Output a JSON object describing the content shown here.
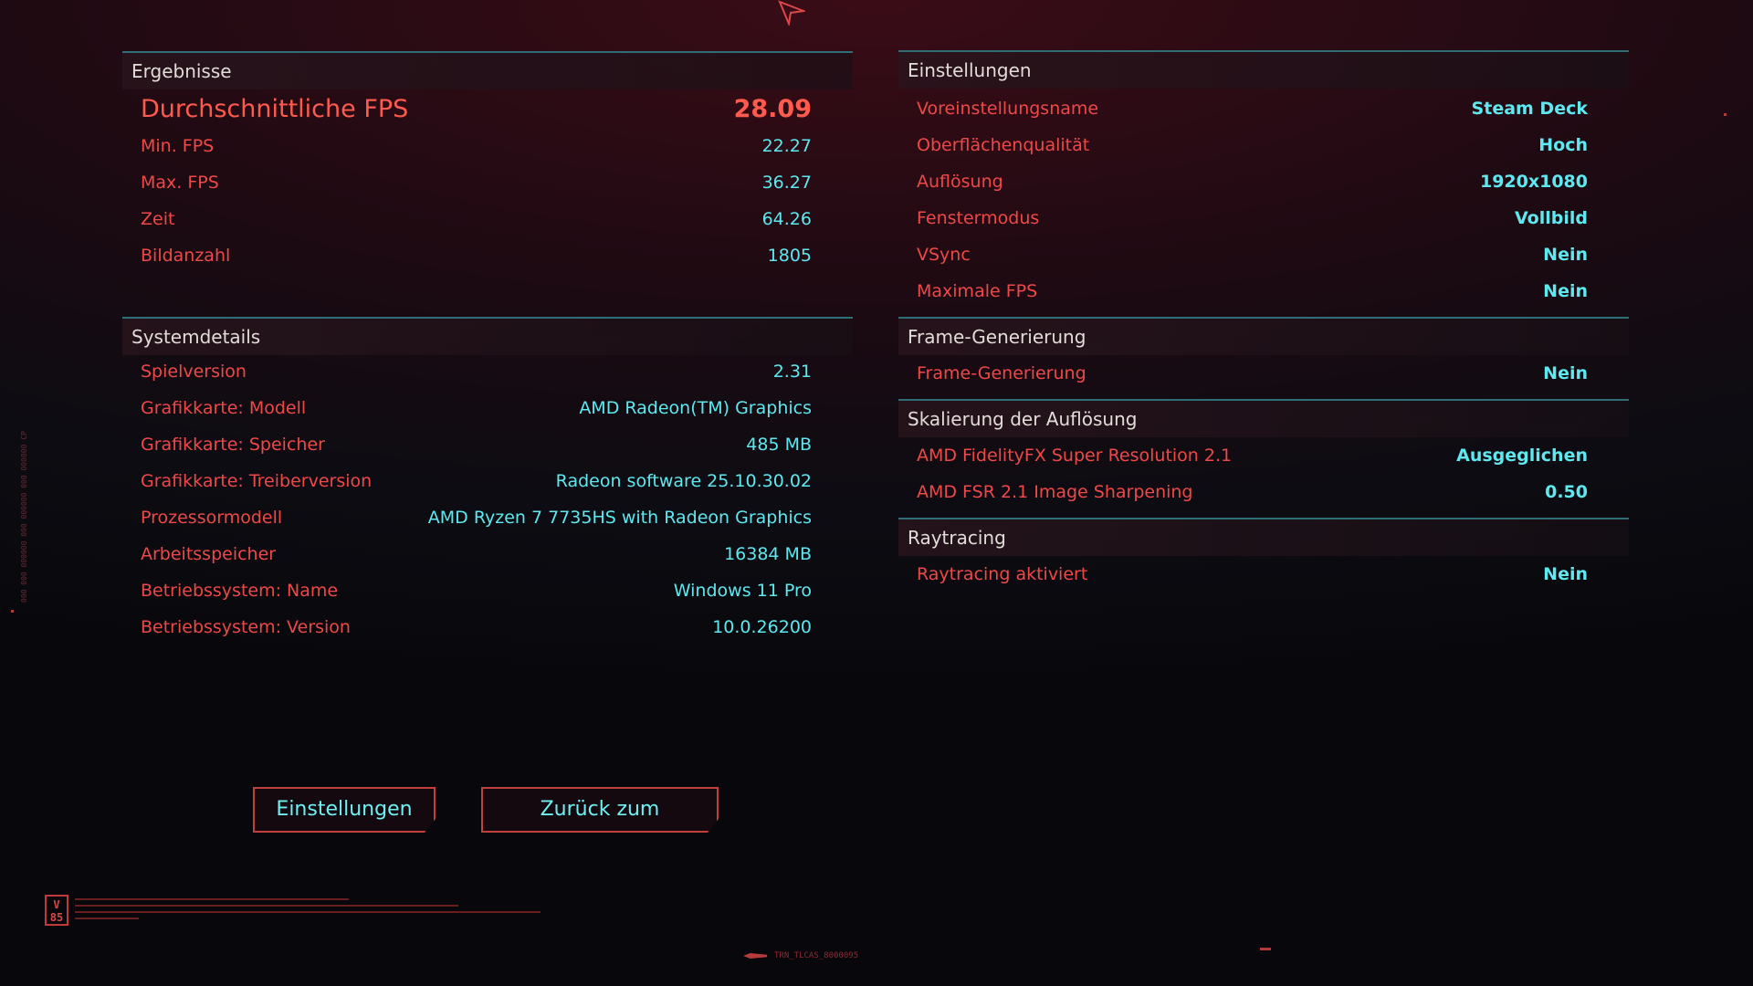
{
  "results": {
    "header": "Ergebnisse",
    "rows": [
      {
        "label": "Durchschnittliche FPS",
        "value": "28.09"
      },
      {
        "label": "Min. FPS",
        "value": "22.27"
      },
      {
        "label": "Max. FPS",
        "value": "36.27"
      },
      {
        "label": "Zeit",
        "value": "64.26"
      },
      {
        "label": "Bildanzahl",
        "value": "1805"
      }
    ]
  },
  "system": {
    "header": "Systemdetails",
    "rows": [
      {
        "label": "Spielversion",
        "value": "2.31"
      },
      {
        "label": "Grafikkarte: Modell",
        "value": "AMD Radeon(TM) Graphics"
      },
      {
        "label": "Grafikkarte: Speicher",
        "value": "485 MB"
      },
      {
        "label": "Grafikkarte: Treiberversion",
        "value": "Radeon software 25.10.30.02"
      },
      {
        "label": "Prozessormodell",
        "value": "AMD Ryzen 7 7735HS with Radeon Graphics"
      },
      {
        "label": "Arbeitsspeicher",
        "value": "16384 MB"
      },
      {
        "label": "Betriebssystem: Name",
        "value": "Windows 11 Pro"
      },
      {
        "label": "Betriebssystem: Version",
        "value": "10.0.26200"
      }
    ]
  },
  "settings": {
    "header": "Einstellungen",
    "rows": [
      {
        "label": "Voreinstellungsname",
        "value": "Steam Deck"
      },
      {
        "label": "Oberflächenqualität",
        "value": "Hoch"
      },
      {
        "label": "Auflösung",
        "value": "1920x1080"
      },
      {
        "label": "Fenstermodus",
        "value": "Vollbild"
      },
      {
        "label": "VSync",
        "value": "Nein"
      },
      {
        "label": "Maximale FPS",
        "value": "Nein"
      }
    ]
  },
  "frame_generation": {
    "header": "Frame-Generierung",
    "rows": [
      {
        "label": "Frame-Generierung",
        "value": "Nein"
      }
    ]
  },
  "scaling": {
    "header": "Skalierung der Auflösung",
    "rows": [
      {
        "label": "AMD FidelityFX Super Resolution 2.1",
        "value": "Ausgeglichen"
      },
      {
        "label": "AMD FSR 2.1 Image Sharpening",
        "value": "0.50"
      }
    ]
  },
  "raytracing": {
    "header": "Raytracing",
    "rows": [
      {
        "label": "Raytracing aktiviert",
        "value": "Nein"
      }
    ]
  },
  "buttons": {
    "settings": "Einstellungen",
    "main_menu": "Zurück zum Hauptmenü"
  },
  "footer": {
    "logo_text": "V 85",
    "tag": "TRN_TLCAS_8000095"
  },
  "colors": {
    "label": "#ee4848",
    "value": "#5ee8ef",
    "divider": "#2f6e76",
    "button_border": "#d84c4c"
  }
}
